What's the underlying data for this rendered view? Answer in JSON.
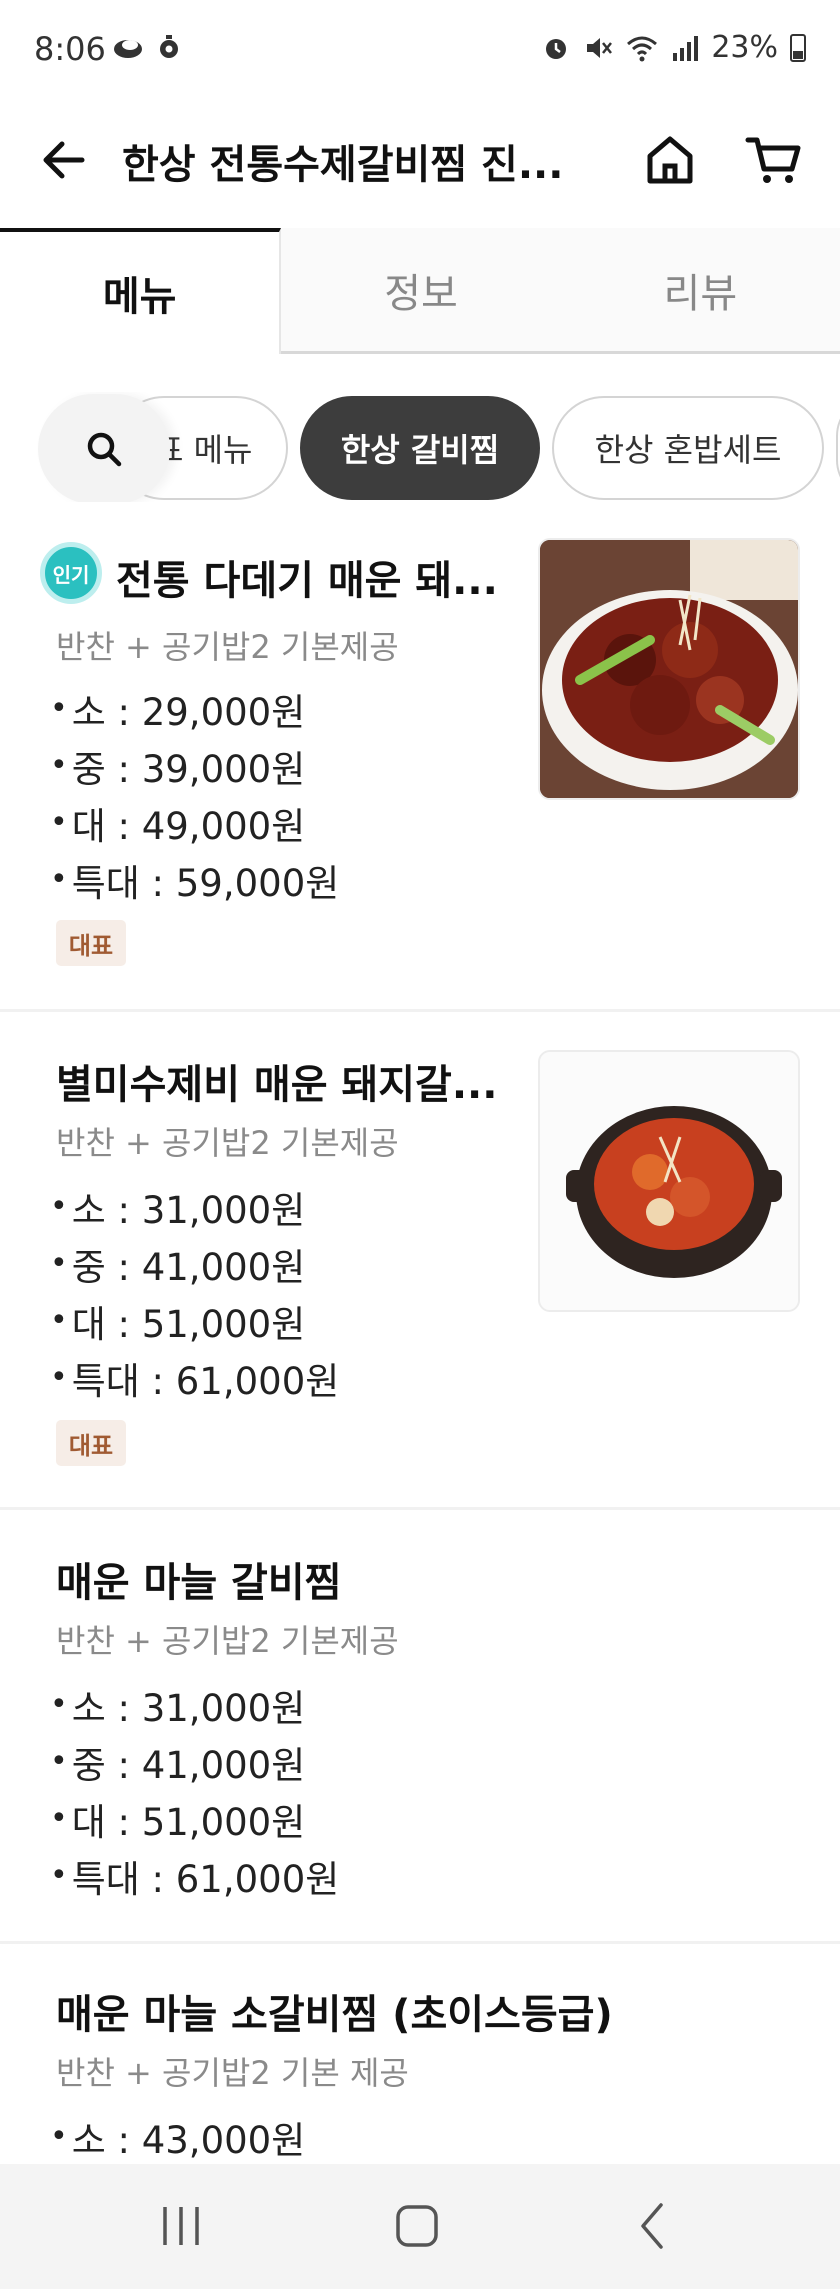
{
  "status_bar": {
    "time": "8:06",
    "battery": "23%",
    "icons": [
      "cloud-icon",
      "location-icon",
      "alarm-icon",
      "mute-icon",
      "wifi-icon",
      "signal-icon",
      "battery-icon"
    ]
  },
  "header": {
    "title": "한상 전통수제갈비찜 진...",
    "icons": [
      "back-arrow-icon",
      "home-icon",
      "cart-icon"
    ]
  },
  "tabs": [
    {
      "label": "메뉴",
      "active": true
    },
    {
      "label": "정보",
      "active": false
    },
    {
      "label": "리뷰",
      "active": false
    }
  ],
  "chips": {
    "search_icon": "search-icon",
    "items": [
      {
        "label": "표 메뉴",
        "selected": false
      },
      {
        "label": "한상 갈비찜",
        "selected": true
      },
      {
        "label": "한상 혼밥세트",
        "selected": false
      }
    ]
  },
  "menu": {
    "items": [
      {
        "name": "전통 다데기 매운 돼...",
        "badge_popular": "인기",
        "desc": "반찬 + 공기밥2 기본제공",
        "prices": [
          "소 : 29,000원",
          "중 : 39,000원",
          "대 : 49,000원",
          "특대 : 59,000원"
        ],
        "badge_rep": "대표"
      },
      {
        "name": "별미수제비 매운 돼지갈...",
        "desc": "반찬 + 공기밥2 기본제공",
        "prices": [
          "소 : 31,000원",
          "중 : 41,000원",
          "대 : 51,000원",
          "특대 : 61,000원"
        ],
        "badge_rep": "대표"
      },
      {
        "name": "매운 마늘 갈비찜",
        "desc": "반찬 + 공기밥2 기본제공",
        "prices": [
          "소 : 31,000원",
          "중 : 41,000원",
          "대 : 51,000원",
          "특대 : 61,000원"
        ]
      },
      {
        "name": "매운 마늘 소갈비찜 (초이스등급)",
        "desc": "반찬 + 공기밥2 기본 제공",
        "prices": [
          "소 : 43,000원"
        ]
      }
    ]
  },
  "colors": {
    "accent_teal": "#2bc0c0",
    "chip_selected": "#3d3d3d",
    "badge_rep_bg": "#f6ede7",
    "badge_rep_text": "#a05a32"
  }
}
